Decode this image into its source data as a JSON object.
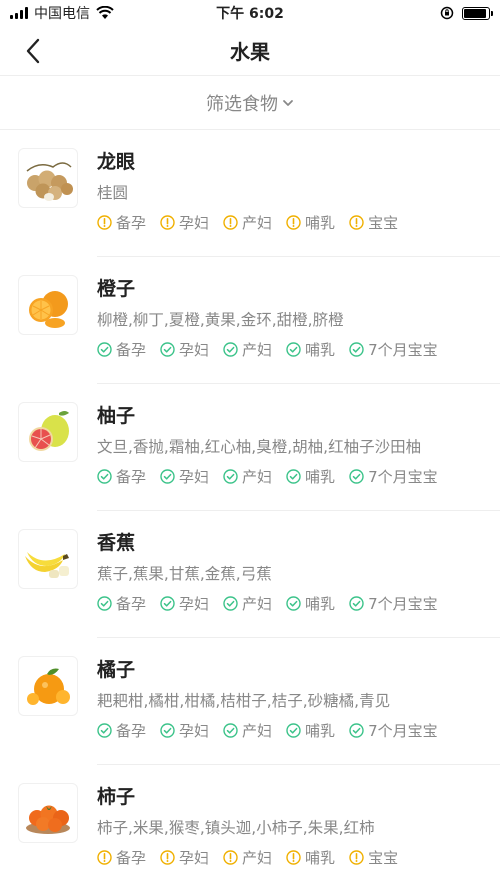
{
  "status_bar": {
    "carrier": "中国电信",
    "time": "下午 6:02",
    "battery_level": 0.9
  },
  "nav": {
    "title": "水果"
  },
  "filter": {
    "label": "筛选食物"
  },
  "colors": {
    "warn": "#f0b000",
    "ok": "#3cc38a",
    "text_dark": "#222222",
    "text_gray": "#888888"
  },
  "items": [
    {
      "name": "龙眼",
      "aliases": "桂圆",
      "tags": [
        {
          "label": "备孕",
          "status": "warn"
        },
        {
          "label": "孕妇",
          "status": "warn"
        },
        {
          "label": "产妇",
          "status": "warn"
        },
        {
          "label": "哺乳",
          "status": "warn"
        },
        {
          "label": "宝宝",
          "status": "warn"
        }
      ]
    },
    {
      "name": "橙子",
      "aliases": "柳橙,柳丁,夏橙,黄果,金环,甜橙,脐橙",
      "tags": [
        {
          "label": "备孕",
          "status": "ok"
        },
        {
          "label": "孕妇",
          "status": "ok"
        },
        {
          "label": "产妇",
          "status": "ok"
        },
        {
          "label": "哺乳",
          "status": "ok"
        },
        {
          "label": "7个月宝宝",
          "status": "ok"
        }
      ]
    },
    {
      "name": "柚子",
      "aliases": "文旦,香抛,霜柚,红心柚,臭橙,胡柚,红柚子沙田柚",
      "tags": [
        {
          "label": "备孕",
          "status": "ok"
        },
        {
          "label": "孕妇",
          "status": "ok"
        },
        {
          "label": "产妇",
          "status": "ok"
        },
        {
          "label": "哺乳",
          "status": "ok"
        },
        {
          "label": "7个月宝宝",
          "status": "ok"
        }
      ]
    },
    {
      "name": "香蕉",
      "aliases": "蕉子,蕉果,甘蕉,金蕉,弓蕉",
      "tags": [
        {
          "label": "备孕",
          "status": "ok"
        },
        {
          "label": "孕妇",
          "status": "ok"
        },
        {
          "label": "产妇",
          "status": "ok"
        },
        {
          "label": "哺乳",
          "status": "ok"
        },
        {
          "label": "7个月宝宝",
          "status": "ok"
        }
      ]
    },
    {
      "name": "橘子",
      "aliases": "耙耙柑,橘柑,柑橘,桔柑子,桔子,砂糖橘,青见",
      "tags": [
        {
          "label": "备孕",
          "status": "ok"
        },
        {
          "label": "孕妇",
          "status": "ok"
        },
        {
          "label": "产妇",
          "status": "ok"
        },
        {
          "label": "哺乳",
          "status": "ok"
        },
        {
          "label": "7个月宝宝",
          "status": "ok"
        }
      ]
    },
    {
      "name": "柿子",
      "aliases": "柿子,米果,猴枣,镇头迦,小柿子,朱果,红柿",
      "tags": [
        {
          "label": "备孕",
          "status": "warn"
        },
        {
          "label": "孕妇",
          "status": "warn"
        },
        {
          "label": "产妇",
          "status": "warn"
        },
        {
          "label": "哺乳",
          "status": "warn"
        },
        {
          "label": "宝宝",
          "status": "warn"
        }
      ]
    }
  ]
}
